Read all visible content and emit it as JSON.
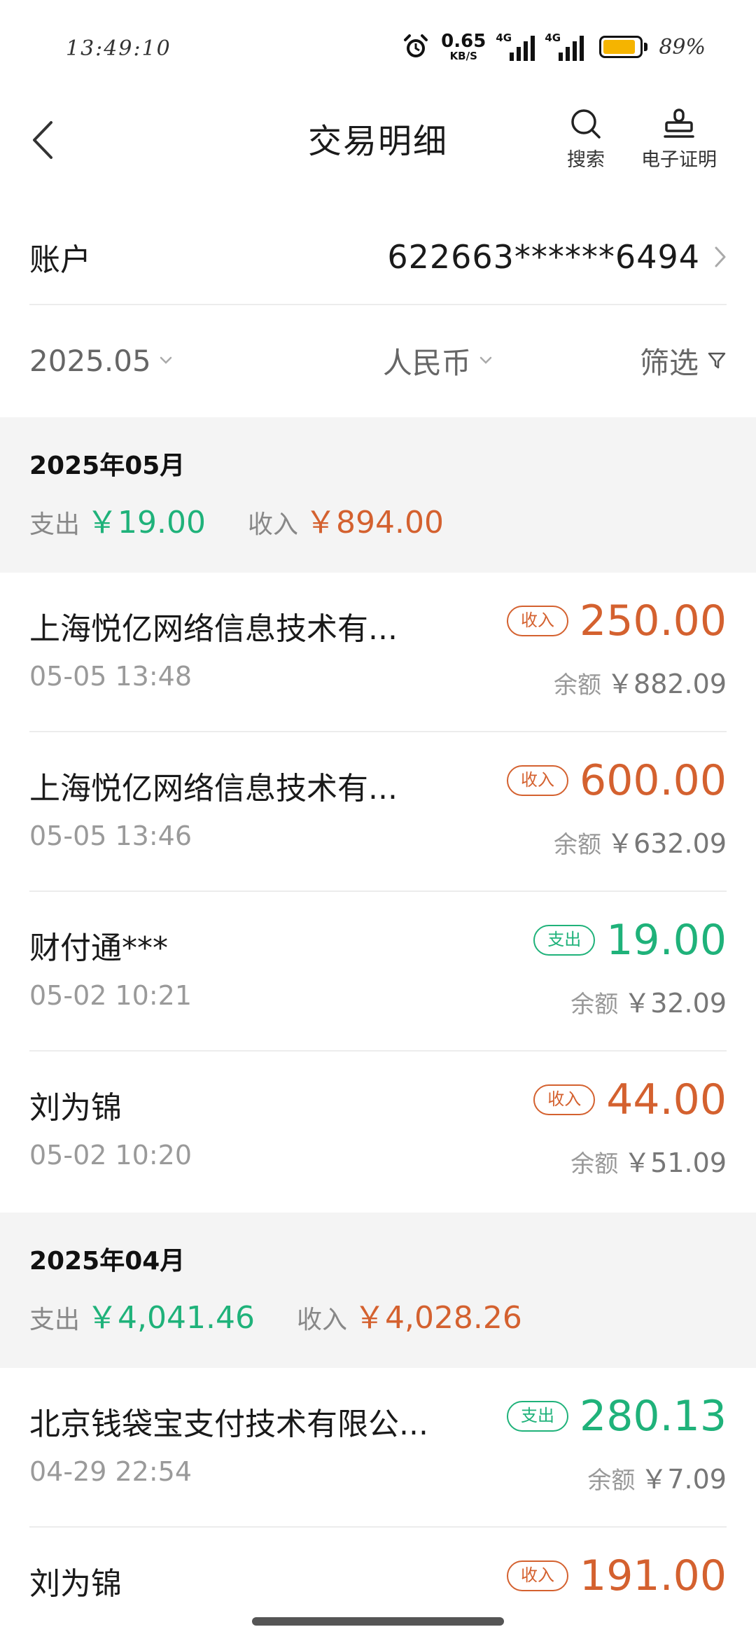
{
  "status_bar": {
    "time": "13:49:10",
    "net_speed": "0.65",
    "net_unit": "KB/S",
    "sim1_tag": "4G",
    "sim2_tag": "4G",
    "battery_level": 0.89,
    "battery_text": "89%"
  },
  "header": {
    "title": "交易明细",
    "search_label": "搜索",
    "cert_label": "电子证明"
  },
  "account": {
    "label": "账户",
    "number": "622663******6494"
  },
  "filters": {
    "date": "2025.05",
    "currency": "人民币",
    "filter_label": "筛选"
  },
  "months": [
    {
      "title": "2025年05月",
      "out_label": "支出",
      "out_value": "￥19.00",
      "in_label": "收入",
      "in_value": "￥894.00"
    },
    {
      "title": "2025年04月",
      "out_label": "支出",
      "out_value": "￥4,041.46",
      "in_label": "收入",
      "in_value": "￥4,028.26"
    }
  ],
  "balance_label": "余额",
  "transactions": [
    {
      "name": "上海悦亿网络信息技术有...",
      "time": "05-05 13:48",
      "type_label": "收入",
      "amount": "250.00",
      "balance": "￥882.09"
    },
    {
      "name": "上海悦亿网络信息技术有...",
      "time": "05-05 13:46",
      "type_label": "收入",
      "amount": "600.00",
      "balance": "￥632.09"
    },
    {
      "name": "财付通***",
      "time": "05-02 10:21",
      "type_label": "支出",
      "amount": "19.00",
      "balance": "￥32.09"
    },
    {
      "name": "刘为锦",
      "time": "05-02 10:20",
      "type_label": "收入",
      "amount": "44.00",
      "balance": "￥51.09"
    },
    {
      "name": "北京钱袋宝支付技术有限公...",
      "time": "04-29 22:54",
      "type_label": "支出",
      "amount": "280.13",
      "balance": "￥7.09"
    },
    {
      "name": "刘为锦",
      "time": "",
      "type_label": "收入",
      "amount": "191.00",
      "balance": ""
    }
  ],
  "colors": {
    "income": "#d4612f",
    "expense": "#1fb27a",
    "section_bg": "#f4f4f4"
  }
}
